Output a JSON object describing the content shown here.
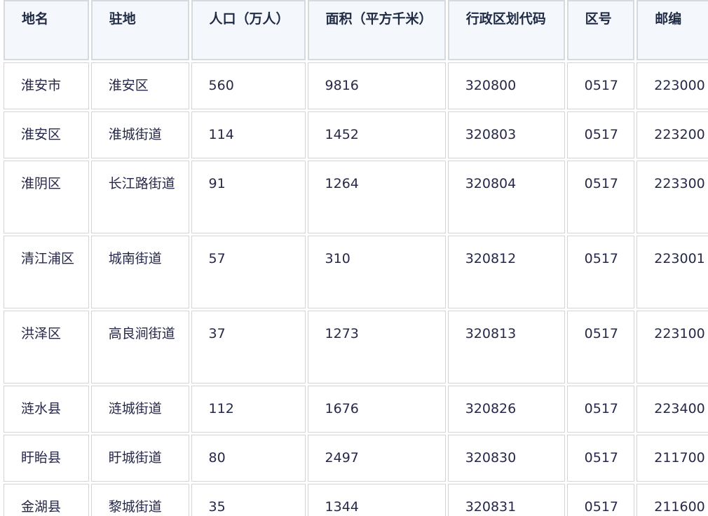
{
  "table": {
    "headers": [
      "地名",
      "驻地",
      "人口（万人）",
      "面积（平方千米）",
      "行政区划代码",
      "区号",
      "邮编"
    ],
    "rows": [
      [
        "淮安市",
        "淮安区",
        "560",
        "9816",
        "320800",
        "0517",
        "223000"
      ],
      [
        "淮安区",
        "淮城街道",
        "114",
        "1452",
        "320803",
        "0517",
        "223200"
      ],
      [
        "淮阴区",
        "长江路街道",
        "91",
        "1264",
        "320804",
        "0517",
        "223300"
      ],
      [
        "清江浦区",
        "城南街道",
        "57",
        "310",
        "320812",
        "0517",
        "223001"
      ],
      [
        "洪泽区",
        "高良涧街道",
        "37",
        "1273",
        "320813",
        "0517",
        "223100"
      ],
      [
        "涟水县",
        "涟城街道",
        "112",
        "1676",
        "320826",
        "0517",
        "223400"
      ],
      [
        "盱眙县",
        "盱城街道",
        "80",
        "2497",
        "320830",
        "0517",
        "211700"
      ],
      [
        "金湖县",
        "黎城街道",
        "35",
        "1344",
        "320831",
        "0517",
        "211600"
      ]
    ]
  }
}
